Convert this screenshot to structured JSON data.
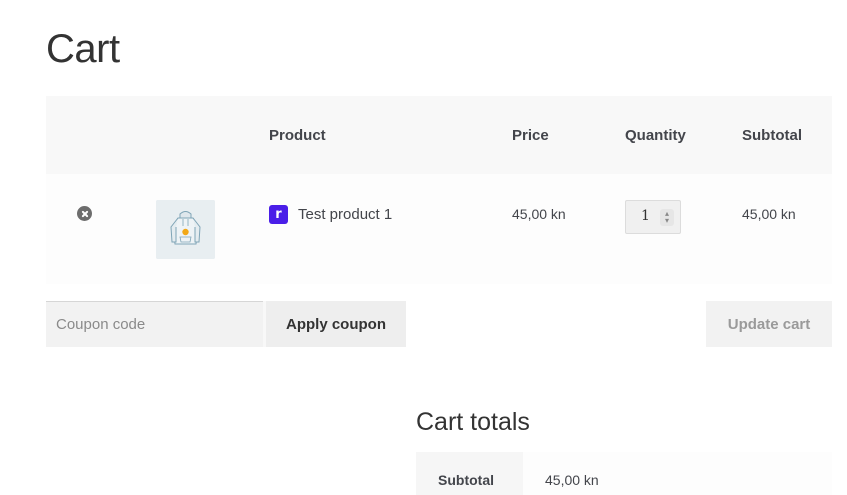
{
  "page": {
    "title": "Cart"
  },
  "cart_table": {
    "headers": {
      "product": "Product",
      "price": "Price",
      "quantity": "Quantity",
      "subtotal": "Subtotal"
    },
    "items": [
      {
        "brand_badge": "r",
        "name": "Test product 1",
        "price": "45,00 kn",
        "quantity": "1",
        "subtotal": "45,00 kn",
        "thumbnail_icon": "hoodie-image"
      }
    ]
  },
  "actions": {
    "coupon_placeholder": "Coupon code",
    "apply_label": "Apply coupon",
    "update_label": "Update cart"
  },
  "totals": {
    "title": "Cart totals",
    "subtotal_label": "Subtotal",
    "subtotal_value": "45,00 kn"
  },
  "colors": {
    "brand_badge": "#4a1ee8",
    "header_bg": "#f8f8f8",
    "text": "#43454b"
  }
}
